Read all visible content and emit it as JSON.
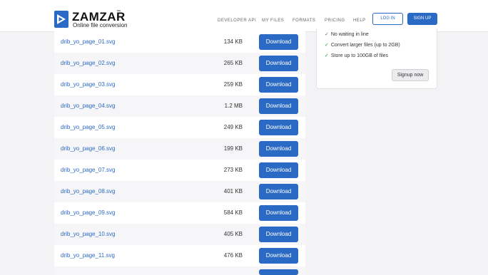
{
  "brand": {
    "name": "ZAMZAR",
    "trademark": "™",
    "tagline": "Online file conversion",
    "accent": "#2a69c4"
  },
  "nav": {
    "items": [
      "DEVELOPER API",
      "MY FILES",
      "FORMATS",
      "PRICING",
      "HELP"
    ],
    "login_label": "LOG IN",
    "signup_label": "SIGN UP"
  },
  "files": [
    {
      "name": "drib_yo_page_01.svg",
      "size": "134 KB",
      "action": "Download"
    },
    {
      "name": "drib_yo_page_02.svg",
      "size": "265 KB",
      "action": "Download"
    },
    {
      "name": "drib_yo_page_03.svg",
      "size": "259 KB",
      "action": "Download"
    },
    {
      "name": "drib_yo_page_04.svg",
      "size": "1.2 MB",
      "action": "Download"
    },
    {
      "name": "drib_yo_page_05.svg",
      "size": "249 KB",
      "action": "Download"
    },
    {
      "name": "drib_yo_page_06.svg",
      "size": "199 KB",
      "action": "Download"
    },
    {
      "name": "drib_yo_page_07.svg",
      "size": "273 KB",
      "action": "Download"
    },
    {
      "name": "drib_yo_page_08.svg",
      "size": "401 KB",
      "action": "Download"
    },
    {
      "name": "drib_yo_page_09.svg",
      "size": "584 KB",
      "action": "Download"
    },
    {
      "name": "drib_yo_page_10.svg",
      "size": "405 KB",
      "action": "Download"
    },
    {
      "name": "drib_yo_page_11.svg",
      "size": "476 KB",
      "action": "Download"
    }
  ],
  "upsell": {
    "features": [
      "No waiting in line",
      "Convert larger files (up to 2GB)",
      "Store up to 100GB of files"
    ],
    "check_icon": "check-icon",
    "signup_now_label": "Signup now"
  }
}
